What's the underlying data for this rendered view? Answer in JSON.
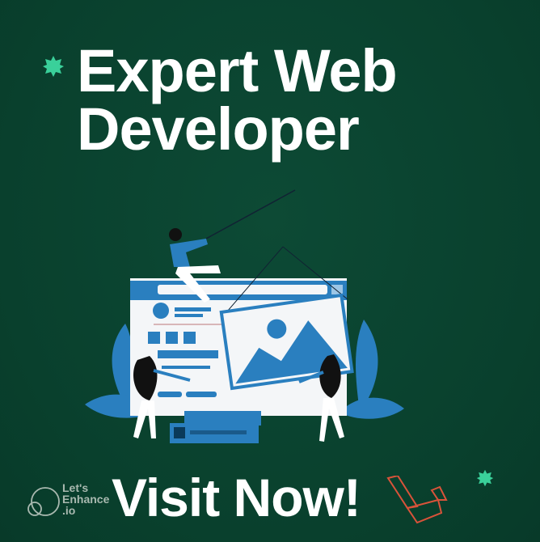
{
  "headline": {
    "line1": "Expert Web",
    "line2": "Developer"
  },
  "cta": {
    "label": "Visit Now!"
  },
  "brand": {
    "line1": "Let's",
    "line2": "Enhance",
    "line3": ".io"
  },
  "colors": {
    "background": "#0a4330",
    "accent": "#3ad09a",
    "illustration_blue": "#2a7fbf",
    "laravel_red": "#d9533a"
  },
  "icons": [
    "sparkle-icon",
    "laravel-logo-icon",
    "letsenhance-logo-icon"
  ]
}
